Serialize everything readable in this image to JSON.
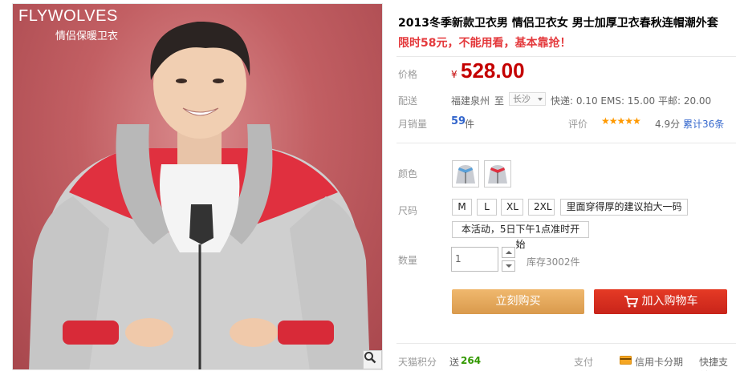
{
  "brand": {
    "logo": "FLYWOLVES",
    "tagline": "情侣保暖卫衣"
  },
  "product": {
    "title": "2013冬季新款卫衣男 情侣卫衣女 男士加厚卫衣春秋连帽潮外套",
    "promo": "限时58元，不能用看，基本靠抢！"
  },
  "price": {
    "label": "价格",
    "currency": "¥",
    "value": "528.00"
  },
  "shipping": {
    "label": "配送",
    "from": "福建泉州",
    "to_word": "至",
    "to": "长沙",
    "rates": "快递: 0.10 EMS: 15.00 平邮: 20.00"
  },
  "sales": {
    "label": "月销量",
    "count": "59",
    "unit": "件",
    "rating_label": "评价",
    "stars": "★★★★★",
    "score": "4.9分",
    "reviews": "累计36条"
  },
  "color": {
    "label": "颜色",
    "options": [
      "light-blue-grey",
      "red-grey"
    ]
  },
  "size": {
    "label": "尺码",
    "options": [
      "M",
      "L",
      "XL",
      "2XL"
    ],
    "note": "里面穿得厚的建议拍大一码",
    "event": "本活动，5日下午1点准时开始"
  },
  "quantity": {
    "label": "数量",
    "value": "1",
    "stock": "库存3002件"
  },
  "actions": {
    "buy": "立刻购买",
    "cart": "加入购物车"
  },
  "footer": {
    "points_label": "天猫积分",
    "points_prefix": "送",
    "points": "264",
    "pay_label": "支付",
    "card": "信用卡分期",
    "quick": "快捷支付"
  },
  "colors": {
    "accent": "#c40000",
    "buy": "#e5a860",
    "cart": "#d62c1f",
    "link": "#3366cc"
  },
  "icons": [
    "zoom-icon",
    "cart-icon",
    "credit-card-icon",
    "chevron-down-icon"
  ]
}
